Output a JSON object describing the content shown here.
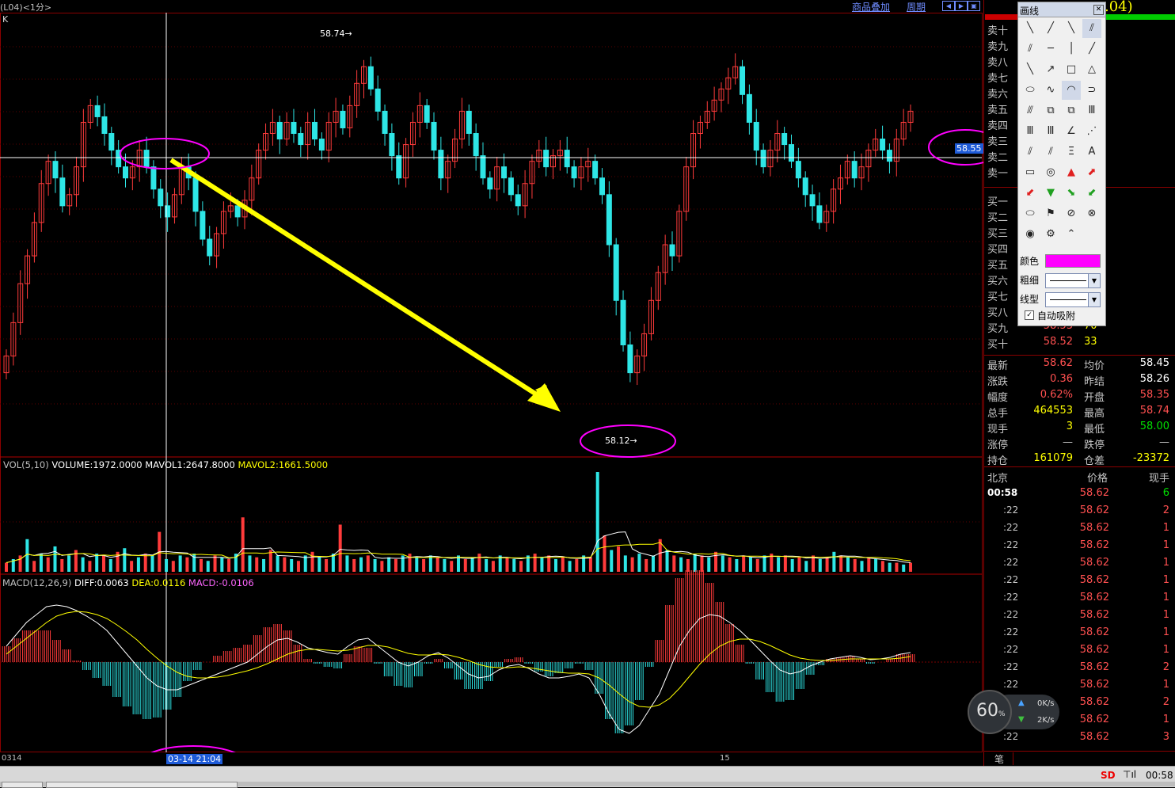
{
  "window": {
    "title": "(L04)<1分>",
    "links": [
      "商品叠加",
      "周期"
    ],
    "code_suffix": ".04)"
  },
  "chart_data": {
    "type": "candlestick",
    "panel_label": "K",
    "price_axis": {
      "range": [
        58.0,
        58.78
      ]
    },
    "price_annotations": {
      "high": "58.74",
      "low": "58.12",
      "crosshair_price": "58.55",
      "crosshair_time": "03-14 21:04"
    },
    "x_labels": [
      "0314",
      "15"
    ],
    "close_series": [
      58.18,
      58.24,
      58.31,
      58.36,
      58.42,
      58.49,
      58.53,
      58.5,
      58.45,
      58.47,
      58.52,
      58.6,
      58.63,
      58.61,
      58.58,
      58.55,
      58.52,
      58.5,
      58.52,
      58.55,
      58.52,
      58.48,
      58.45,
      58.43,
      58.47,
      58.52,
      58.5,
      58.44,
      58.39,
      58.36,
      58.4,
      58.44,
      58.45,
      58.43,
      58.46,
      58.5,
      58.55,
      58.58,
      58.6,
      58.57,
      58.6,
      58.58,
      58.56,
      58.6,
      58.57,
      58.55,
      58.6,
      58.62,
      58.59,
      58.63,
      58.67,
      58.7,
      58.66,
      58.62,
      58.58,
      58.54,
      58.5,
      58.56,
      58.6,
      58.63,
      58.6,
      58.55,
      58.5,
      58.53,
      58.57,
      58.62,
      58.58,
      58.54,
      58.5,
      58.48,
      58.52,
      58.5,
      58.47,
      58.45,
      58.49,
      58.53,
      58.55,
      58.52,
      58.54,
      58.55,
      58.52,
      58.5,
      58.52,
      58.53,
      58.5,
      58.47,
      58.38,
      58.28,
      58.2,
      58.15,
      58.18,
      58.22,
      58.28,
      58.33,
      58.38,
      58.36,
      58.44,
      58.52,
      58.58,
      58.6,
      58.62,
      58.64,
      58.66,
      58.68,
      58.7,
      58.65,
      58.6,
      58.55,
      58.52,
      58.55,
      58.58,
      58.56,
      58.53,
      58.5,
      58.47,
      58.45,
      58.42,
      58.44,
      58.48,
      58.5,
      58.53,
      58.5,
      58.52,
      58.55,
      58.57,
      58.55,
      58.53,
      58.57,
      58.6,
      58.62
    ],
    "volume": {
      "label": "VOL(5,10)",
      "legend": [
        "VOLUME:1972.0000",
        "MAVOL1:2647.8000",
        "MAVOL2:1661.5000"
      ],
      "values": [
        5,
        7,
        9,
        18,
        6,
        10,
        8,
        14,
        7,
        9,
        12,
        8,
        6,
        10,
        9,
        7,
        11,
        13,
        6,
        8,
        10,
        9,
        22,
        7,
        6,
        9,
        8,
        10,
        7,
        6,
        9,
        8,
        7,
        10,
        30,
        9,
        8,
        7,
        12,
        9,
        8,
        7,
        6,
        9,
        11,
        8,
        7,
        10,
        26,
        9,
        7,
        8,
        9,
        7,
        6,
        8,
        7,
        9,
        10,
        8,
        7,
        9,
        8,
        7,
        6,
        9,
        7,
        8,
        10,
        7,
        6,
        9,
        8,
        7,
        6,
        9,
        10,
        8,
        9,
        7,
        8,
        6,
        7,
        9,
        8,
        55,
        20,
        12,
        14,
        9,
        8,
        10,
        7,
        9,
        18,
        12,
        9,
        8,
        7,
        10,
        9,
        8,
        11,
        9,
        8,
        7,
        9,
        8,
        7,
        9,
        10,
        8,
        9,
        7,
        8,
        6,
        9,
        7,
        8,
        11,
        9,
        8,
        7,
        6,
        8,
        7,
        6,
        5,
        5,
        4,
        5
      ]
    },
    "macd": {
      "label": "MACD(12,26,9)",
      "legend": [
        "DIFF:0.0063",
        "DEA:0.0116",
        "MACD:-0.0106"
      ],
      "diff": [
        0.02,
        0.035,
        0.05,
        0.06,
        0.07,
        0.072,
        0.07,
        0.065,
        0.058,
        0.05,
        0.04,
        0.025,
        0.01,
        -0.005,
        -0.02,
        -0.03,
        -0.035,
        -0.035,
        -0.03,
        -0.025,
        -0.02,
        -0.015,
        -0.01,
        -0.005,
        0,
        0.01,
        0.02,
        0.028,
        0.03,
        0.025,
        0.018,
        0.015,
        0.012,
        0.01,
        0.02,
        0.028,
        0.03,
        0.02,
        0.01,
        0.0,
        -0.005,
        0.0,
        0.008,
        0.012,
        0.005,
        -0.005,
        -0.015,
        -0.02,
        -0.018,
        -0.01,
        -0.005,
        -0.003,
        -0.008,
        -0.015,
        -0.02,
        -0.02,
        -0.018,
        -0.015,
        -0.02,
        -0.04,
        -0.065,
        -0.085,
        -0.09,
        -0.08,
        -0.06,
        -0.04,
        -0.01,
        0.02,
        0.04,
        0.055,
        0.06,
        0.058,
        0.05,
        0.04,
        0.028,
        0.015,
        0.002,
        -0.01,
        -0.015,
        -0.012,
        -0.005,
        0.0,
        0.004,
        0.006,
        0.008,
        0.006,
        0.003,
        0.004,
        0.006,
        0.01,
        0.012
      ],
      "dea": [
        0.01,
        0.02,
        0.03,
        0.04,
        0.05,
        0.058,
        0.062,
        0.064,
        0.063,
        0.06,
        0.055,
        0.047,
        0.038,
        0.028,
        0.016,
        0.005,
        -0.005,
        -0.013,
        -0.018,
        -0.02,
        -0.02,
        -0.019,
        -0.017,
        -0.014,
        -0.011,
        -0.007,
        -0.002,
        0.004,
        0.01,
        0.014,
        0.016,
        0.016,
        0.015,
        0.014,
        0.015,
        0.018,
        0.021,
        0.021,
        0.019,
        0.015,
        0.011,
        0.009,
        0.009,
        0.01,
        0.009,
        0.006,
        0.002,
        -0.003,
        -0.006,
        -0.007,
        -0.007,
        -0.006,
        -0.007,
        -0.009,
        -0.011,
        -0.013,
        -0.014,
        -0.014,
        -0.015,
        -0.02,
        -0.029,
        -0.04,
        -0.05,
        -0.056,
        -0.057,
        -0.054,
        -0.046,
        -0.033,
        -0.018,
        -0.003,
        0.01,
        0.02,
        0.026,
        0.029,
        0.029,
        0.026,
        0.021,
        0.015,
        0.009,
        0.005,
        0.003,
        0.002,
        0.002,
        0.003,
        0.004,
        0.004,
        0.004,
        0.004,
        0.004,
        0.005,
        0.007
      ]
    }
  },
  "order_book": {
    "asks": [
      {
        "name": "卖十"
      },
      {
        "name": "卖九"
      },
      {
        "name": "卖八"
      },
      {
        "name": "卖七"
      },
      {
        "name": "卖六"
      },
      {
        "name": "卖五"
      },
      {
        "name": "卖四"
      },
      {
        "name": "卖三"
      },
      {
        "name": "卖二"
      },
      {
        "name": "卖一"
      }
    ],
    "bids": [
      {
        "name": "买一"
      },
      {
        "name": "买二"
      },
      {
        "name": "买三"
      },
      {
        "name": "买四"
      },
      {
        "name": "买五"
      },
      {
        "name": "买六"
      },
      {
        "name": "买七"
      },
      {
        "name": "买八"
      },
      {
        "name": "买九",
        "price": "58.53",
        "vol": "70"
      },
      {
        "name": "买十",
        "price": "58.52",
        "vol": "33"
      }
    ]
  },
  "quote": [
    {
      "n1": "最新",
      "v1": "58.62",
      "c1": "#ff5050",
      "n2": "均价",
      "v2": "58.45",
      "c2": "#ffffff"
    },
    {
      "n1": "涨跌",
      "v1": "0.36",
      "c1": "#ff5050",
      "n2": "昨结",
      "v2": "58.26",
      "c2": "#ffffff"
    },
    {
      "n1": "幅度",
      "v1": "0.62%",
      "c1": "#ff5050",
      "n2": "开盘",
      "v2": "58.35",
      "c2": "#ff5050"
    },
    {
      "n1": "总手",
      "v1": "464553",
      "c1": "#ffff00",
      "n2": "最高",
      "v2": "58.74",
      "c2": "#ff5050"
    },
    {
      "n1": "现手",
      "v1": "3",
      "c1": "#ffff00",
      "n2": "最低",
      "v2": "58.00",
      "c2": "#00e000"
    },
    {
      "n1": "涨停",
      "v1": "—",
      "c1": "#c8c8c8",
      "n2": "跌停",
      "v2": "—",
      "c2": "#c8c8c8"
    },
    {
      "n1": "持仓",
      "v1": "161079",
      "c1": "#ffff00",
      "n2": "仓差",
      "v2": "-23372",
      "c2": "#ffff00"
    }
  ],
  "ticks": {
    "headers": [
      "北京",
      "价格",
      "现手"
    ],
    "rows": [
      {
        "time": "00:58",
        "price": "58.62",
        "vol": "6",
        "vcolor": "#00e000"
      },
      {
        "time": ":22",
        "price": "58.62",
        "vol": "2",
        "vcolor": "#ff5050"
      },
      {
        "time": ":22",
        "price": "58.62",
        "vol": "1",
        "vcolor": "#ff5050"
      },
      {
        "time": ":22",
        "price": "58.62",
        "vol": "1",
        "vcolor": "#ff5050"
      },
      {
        "time": ":22",
        "price": "58.62",
        "vol": "1",
        "vcolor": "#ff5050"
      },
      {
        "time": ":22",
        "price": "58.62",
        "vol": "1",
        "vcolor": "#ff5050"
      },
      {
        "time": ":22",
        "price": "58.62",
        "vol": "1",
        "vcolor": "#ff5050"
      },
      {
        "time": ":22",
        "price": "58.62",
        "vol": "1",
        "vcolor": "#ff5050"
      },
      {
        "time": ":22",
        "price": "58.62",
        "vol": "1",
        "vcolor": "#ff5050"
      },
      {
        "time": ":22",
        "price": "58.62",
        "vol": "1",
        "vcolor": "#ff5050"
      },
      {
        "time": ":22",
        "price": "58.62",
        "vol": "2",
        "vcolor": "#ff5050"
      },
      {
        "time": ":22",
        "price": "58.62",
        "vol": "1",
        "vcolor": "#ff5050"
      },
      {
        "time": ":22",
        "price": "58.62",
        "vol": "2",
        "vcolor": "#ff5050"
      },
      {
        "time": ":22",
        "price": "58.62",
        "vol": "1",
        "vcolor": "#ff5050"
      },
      {
        "time": ":22",
        "price": "58.62",
        "vol": "3",
        "vcolor": "#ff5050"
      }
    ],
    "footer_tab": "笔"
  },
  "toolbox": {
    "title": "画线",
    "color_label": "颜色",
    "color_value": "#ff00ff",
    "width_label": "粗细",
    "style_label": "线型",
    "snap_label": "自动吸附",
    "tools": [
      "line-tool",
      "ray-tool",
      "segment-tool",
      "parallel-tool",
      "channel-tool",
      "horizontal-line-tool",
      "vertical-line-tool",
      "trend-tool",
      "arrow-line-tool",
      "up-arrow-line-tool",
      "rectangle-tool",
      "triangle-tool",
      "ellipse-tool",
      "wave-tool",
      "arc-tool",
      "curve-tool",
      "fibonacci-tool",
      "gann-tool",
      "fan-tool",
      "grid-tool",
      "cycle-tool",
      "period-tool",
      "angle-tool",
      "speed-line-tool",
      "golden-tool",
      "ratio-tool",
      "gann-line-tool",
      "text-tool",
      "ruler-tool",
      "target-tool",
      "up-arrow-tool",
      "up-right-arrow-tool",
      "down-left-arrow-tool",
      "down-arrow-tool",
      "down-right-arrow-tool",
      "left-down-arrow-tool",
      "eraser-tool",
      "flag-tool",
      "hide-tool",
      "show-all-tool",
      "eye-tool",
      "settings-tool",
      "collapse-tool"
    ]
  },
  "speed_widget": {
    "percent": "60",
    "percent_sign": "%",
    "up": "0K/s",
    "down": "2K/s"
  },
  "status_bar": {
    "sd": "SD",
    "clock": "00:58"
  }
}
